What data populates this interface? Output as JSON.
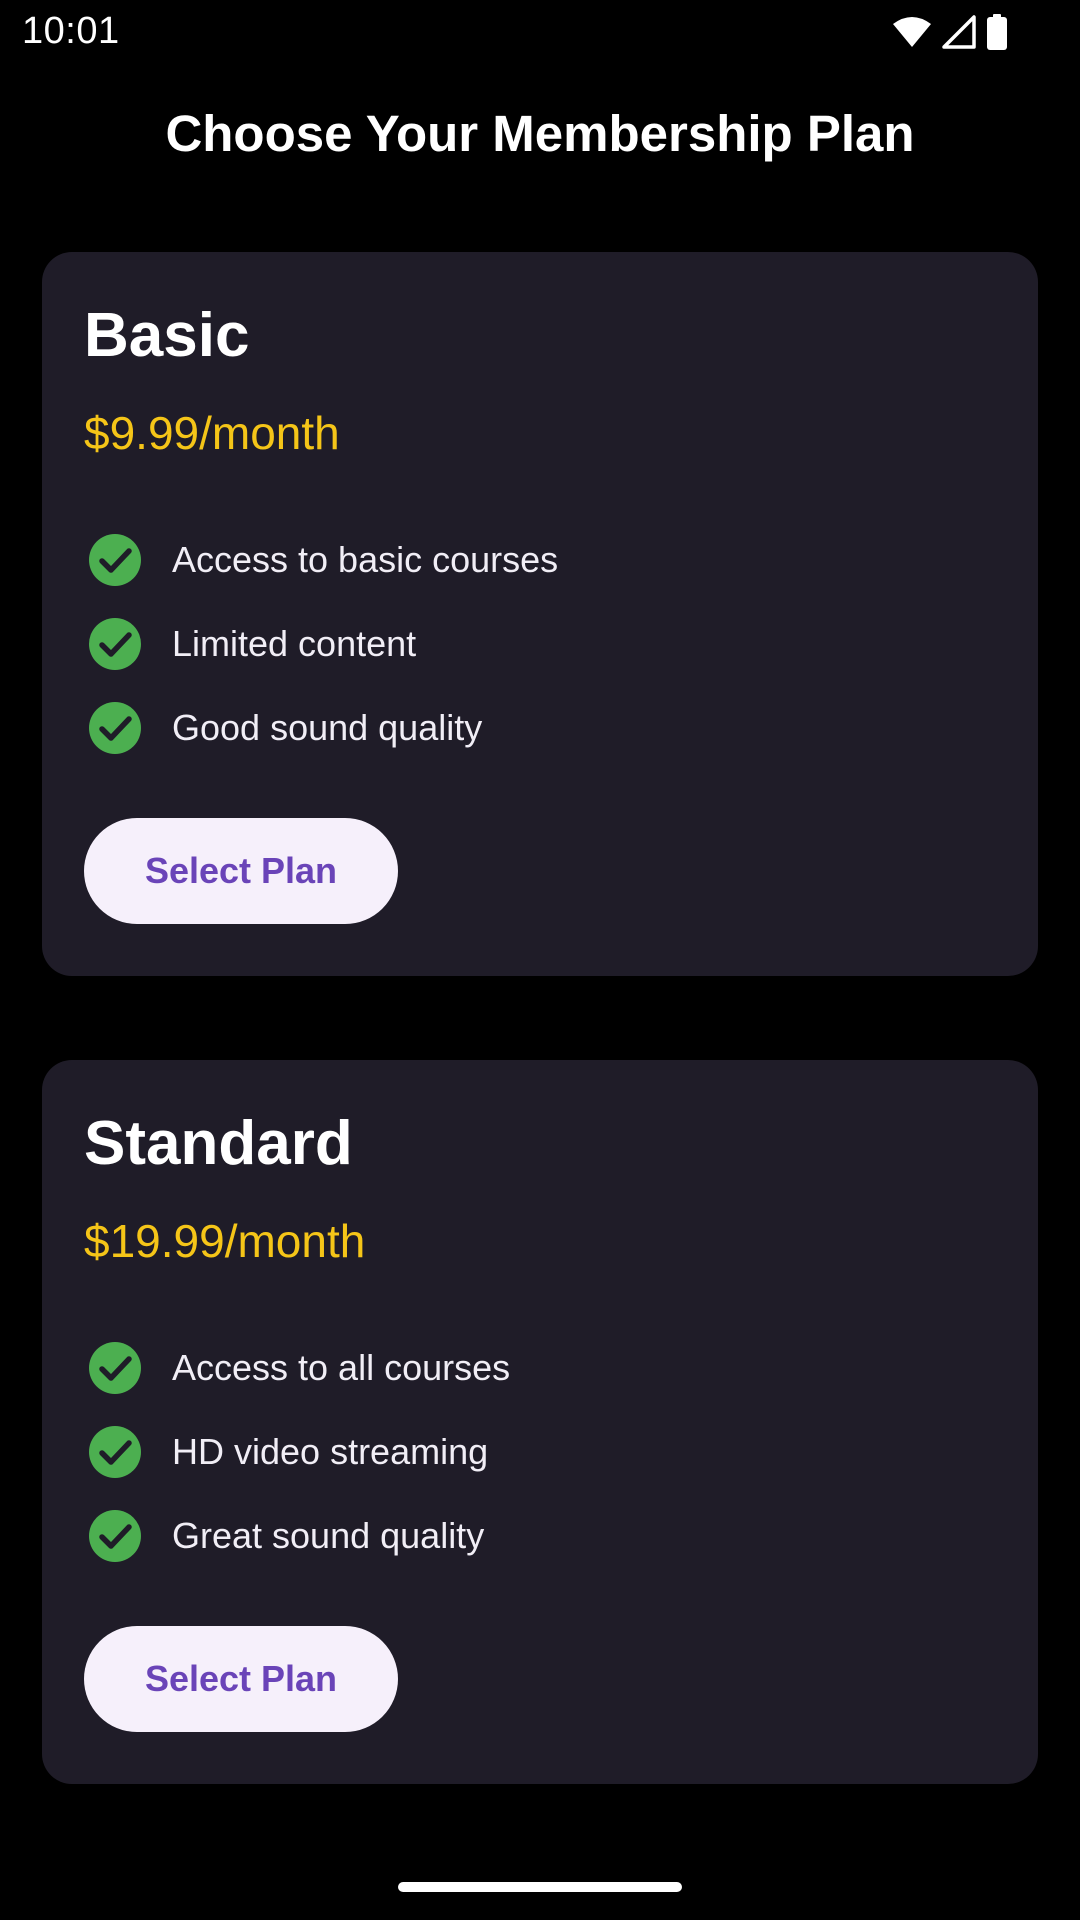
{
  "status_bar": {
    "time": "10:01",
    "icons": [
      "wifi-icon",
      "cell-signal-icon",
      "battery-icon"
    ]
  },
  "header": {
    "title": "Choose Your Membership Plan"
  },
  "plans": [
    {
      "name": "Basic",
      "price": "$9.99/month",
      "features": [
        "Access to basic courses",
        "Limited content",
        "Good sound quality"
      ],
      "button_label": "Select Plan"
    },
    {
      "name": "Standard",
      "price": "$19.99/month",
      "features": [
        "Access to all courses",
        "HD video streaming",
        "Great sound quality"
      ],
      "button_label": "Select Plan"
    }
  ],
  "colors": {
    "background": "#000000",
    "card": "#1f1c28",
    "price": "#f5c518",
    "check": "#4caf50",
    "button_bg": "#f6f0fb",
    "button_text": "#6a44b8"
  }
}
